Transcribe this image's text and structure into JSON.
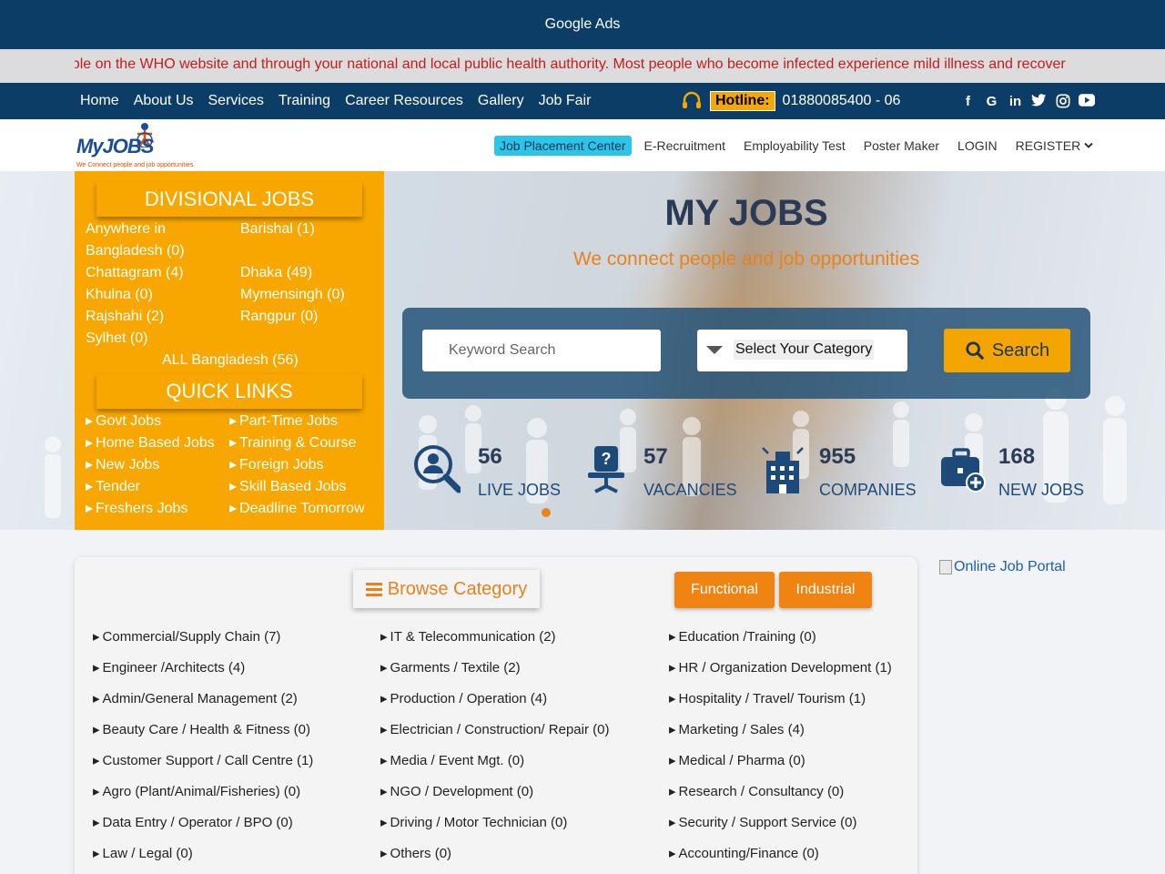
{
  "ads": {
    "label": "Google Ads"
  },
  "ticker": {
    "text": "available on the WHO website and through your national and local public health authority. Most people who become infected experience mild illness and recover"
  },
  "nav": {
    "items": [
      "Home",
      "About Us",
      "Services",
      "Training",
      "Career Resources",
      "Gallery",
      "Job Fair"
    ],
    "hotline_label": "Hotline:",
    "hotline_number": "01880085400 - 06",
    "socials": [
      "facebook-icon",
      "google-icon",
      "linkedin-icon",
      "twitter-icon",
      "instagram-icon",
      "youtube-icon"
    ]
  },
  "header": {
    "logo_text": "MyJOBS",
    "logo_tagline": "We Connect people and job opportunities",
    "menu": [
      "Job Placement Center",
      "E-Recruitment",
      "Employability Test",
      "Poster Maker",
      "LOGIN",
      "REGISTER"
    ]
  },
  "divisional": {
    "title": "DIVISIONAL JOBS",
    "items": [
      "Anywhere in Bangladesh (0)",
      "Barishal (1)",
      "Chattagram (4)",
      "Dhaka (49)",
      "Khulna (0)",
      "Mymensingh (0)",
      "Rajshahi (2)",
      "Rangpur (0)",
      "Sylhet (0)"
    ],
    "all": "ALL Bangladesh (56)"
  },
  "quick_links": {
    "title": "QUICK LINKS",
    "items": [
      "Govt Jobs",
      "Part-Time Jobs",
      "Home Based Jobs",
      "Training & Course",
      "New Jobs",
      "Foreign Jobs",
      "Tender",
      "Skill Based Jobs",
      "Freshers Jobs",
      "Deadline Tomorrow"
    ]
  },
  "hero": {
    "title": "MY JOBS",
    "tagline": "We connect people and job opportunities"
  },
  "search": {
    "keyword_placeholder": "Keyword Search",
    "category_label": "Select Your Category",
    "button": "Search"
  },
  "stats": [
    {
      "value": "56",
      "label": "LIVE JOBS",
      "icon": "search-people-icon"
    },
    {
      "value": "57",
      "label": "VACANCIES",
      "icon": "chair-question-icon"
    },
    {
      "value": "955",
      "label": "COMPANIES",
      "icon": "building-icon"
    },
    {
      "value": "168",
      "label": "NEW JOBS",
      "icon": "briefcase-plus-icon"
    }
  ],
  "browse": {
    "title": "Browse Category",
    "tabs": [
      "Functional",
      "Industrial"
    ],
    "categories": [
      [
        "Commercial/Supply Chain (7)",
        "IT & Telecommunication (2)",
        "Education /Training (0)"
      ],
      [
        "Engineer /Architects (4)",
        "Garments / Textile (2)",
        "HR / Organization Development (1)"
      ],
      [
        "Admin/General Management (2)",
        "Production / Operation (4)",
        "Hospitality / Travel/ Tourism (1)"
      ],
      [
        "Beauty Care / Health & Fitness (0)",
        "Electrician / Construction/ Repair (0)",
        "Marketing / Sales (4)"
      ],
      [
        "Customer Support / Call Centre (1)",
        "Media / Event Mgt. (0)",
        "Medical / Pharma (0)"
      ],
      [
        "Agro (Plant/Animal/Fisheries) (0)",
        "NGO / Development (0)",
        "Research / Consultancy (0)"
      ],
      [
        "Data Entry / Operator / BPO (0)",
        "Driving / Motor Technician (0)",
        "Security / Support Service (0)"
      ],
      [
        "Law / Legal (0)",
        "Others (0)",
        "Accounting/Finance (0)"
      ]
    ]
  },
  "portal_image": {
    "alt": "Online Job Portal"
  },
  "colors": {
    "navy": "#0b3d66",
    "orange": "#f8a700",
    "accent": "#ef8412",
    "cyan": "#29c6ea"
  }
}
